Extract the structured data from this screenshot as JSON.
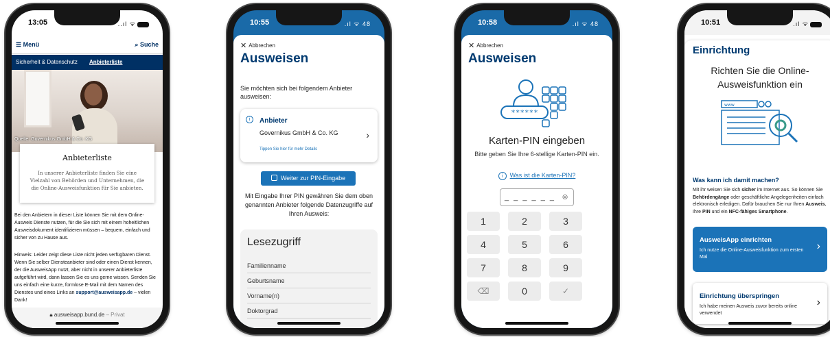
{
  "phone1": {
    "status": {
      "time": "13:05",
      "icons": "..ıl ᯤ"
    },
    "menu_label": "Menü",
    "search_label": "Suche",
    "breadcrumb": {
      "parent": "Sicherheit & Datenschutz",
      "current": "Anbieterliste"
    },
    "hero_caption": "Quelle: Governikus GmbH & Co. KG",
    "card": {
      "title": "Anbieterliste",
      "text": "In unserer Anbieterliste finden Sie eine Vielzahl von Behörden und Unternehmen, die die Online-Ausweisfunktion für Sie anbieten."
    },
    "paragraph1": "Bei den Anbietern in dieser Liste können Sie mit dem Online-Ausweis Dienste nutzen, für die Sie sich mit einem hoheitlichen Ausweisdokument identifizieren müssen – bequem, einfach und sicher von zu Hause aus.",
    "paragraph2_start": "Hinweis: Leider zeigt diese Liste nicht jeden verfügbaren Dienst. Wenn Sie selber Diensteanbieter sind oder einen Dienst kennen, der die AusweisApp nutzt, aber nicht in unserer Anbieterliste aufgeführt wird, dann lassen Sie es uns gerne wissen. Senden Sie uns einfach eine kurze, formlose E-Mail mit dem Namen des Dienstes und eines Links an",
    "paragraph2_email": "support@ausweisapp.de",
    "paragraph2_end": " – vielen Dank!",
    "url": {
      "domain": "ausweisapp.bund.de",
      "mode": " – Privat"
    }
  },
  "phone2": {
    "status": {
      "time": "10:55",
      "icons": ".ıl ᯤ 48"
    },
    "cancel_label": "Abbrechen",
    "heading": "Ausweisen",
    "intro": "Sie möchten sich bei folgendem Anbieter ausweisen:",
    "provider": {
      "label": "Anbieter",
      "name": "Governikus GmbH & Co. KG",
      "details_link": "Tippen Sie hier für mehr Details"
    },
    "continue_button": "Weiter zur PIN-Eingabe",
    "access_text": "Mit Eingabe Ihrer PIN gewähren Sie dem oben genannten Anbieter folgende Datenzugriffe auf Ihren Ausweis:",
    "read_access": {
      "title": "Lesezugriff",
      "rows": [
        "Familienname",
        "Geburtsname",
        "Vorname(n)",
        "Doktorgrad"
      ]
    }
  },
  "phone3": {
    "status": {
      "time": "10:58",
      "icons": ".ıl ᯤ 48"
    },
    "cancel_label": "Abbrechen",
    "heading": "Ausweisen",
    "illustration_pin": "******",
    "title": "Karten-PIN eingeben",
    "subtitle": "Bitte geben Sie Ihre 6-stellige Karten-PIN ein.",
    "help_link": "Was ist die Karten-PIN?",
    "pin_placeholder": "_ _ _ _ _ _",
    "keys": [
      "1",
      "2",
      "3",
      "4",
      "5",
      "6",
      "7",
      "8",
      "9",
      "⌫",
      "0",
      "✓"
    ]
  },
  "phone4": {
    "status": {
      "time": "10:51",
      "icons": ".ıl ᯤ"
    },
    "heading": "Einrichtung",
    "title": "Richten Sie die Online-Ausweisfunktion ein",
    "illustration_text": "www",
    "question": "Was kann ich damit machen?",
    "body_html_parts": {
      "p1": "Mit ihr weisen Sie sich ",
      "b1": "sicher",
      "p2": " im Internet aus. So können Sie ",
      "b2": "Behördengänge",
      "p3": " oder geschäftliche Angelegenheiten einfach elektronisch erledigen. Dafür brauchen Sie nur Ihren ",
      "b3": "Ausweis",
      "p4": ", Ihre ",
      "b4": "PIN",
      "p5": " und ein ",
      "b5": "NFC-fähiges Smartphone",
      "p6": "."
    },
    "setup_button": {
      "title": "AusweisApp einrichten",
      "subtitle": "Ich nutze die Online-Ausweisfunktion zum ersten Mal"
    },
    "skip_button": {
      "title": "Einrichtung überspringen",
      "subtitle": "Ich habe meinen Ausweis zuvor bereits online verwendet"
    }
  },
  "colors": {
    "brand_blue": "#1b73b8",
    "navy": "#003a70",
    "website_navy": "#003064"
  }
}
